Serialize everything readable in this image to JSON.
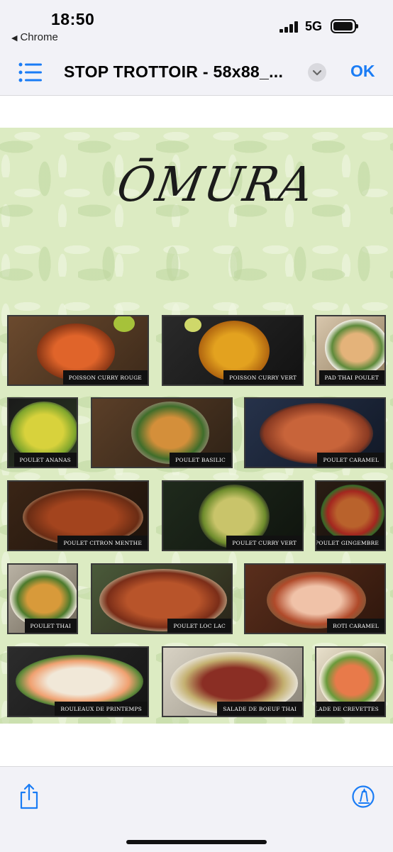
{
  "status": {
    "time": "18:50",
    "back_app": "Chrome",
    "network": "5G"
  },
  "nav": {
    "title": "STOP TROTTOIR - 58x88_...",
    "ok_label": "OK"
  },
  "document": {
    "logo": "ŌMURA",
    "dishes": [
      "POISSON CURRY ROUGE",
      "POISSON CURRY VERT",
      "PAD THAI POULET",
      "POULET ANANAS",
      "POULET BASILIC",
      "POULET CARAMEL",
      "POULET CITRON MENTHE",
      "POULET CURRY VERT",
      "POULET GINGEMBRE",
      "POULET THAI",
      "POULET LOC LAC",
      "ROTI CARAMEL",
      "ROULEAUX DE PRINTEMPS",
      "SALADE DE BOEUF THAI",
      "SALADE DE CREVETTES"
    ]
  },
  "icons": {
    "list": "list-icon",
    "chevron": "chevron-down-icon",
    "share": "share-icon",
    "markup": "markup-icon"
  },
  "colors": {
    "accent": "#1a7cf5",
    "page_bg": "#dcebc2"
  }
}
